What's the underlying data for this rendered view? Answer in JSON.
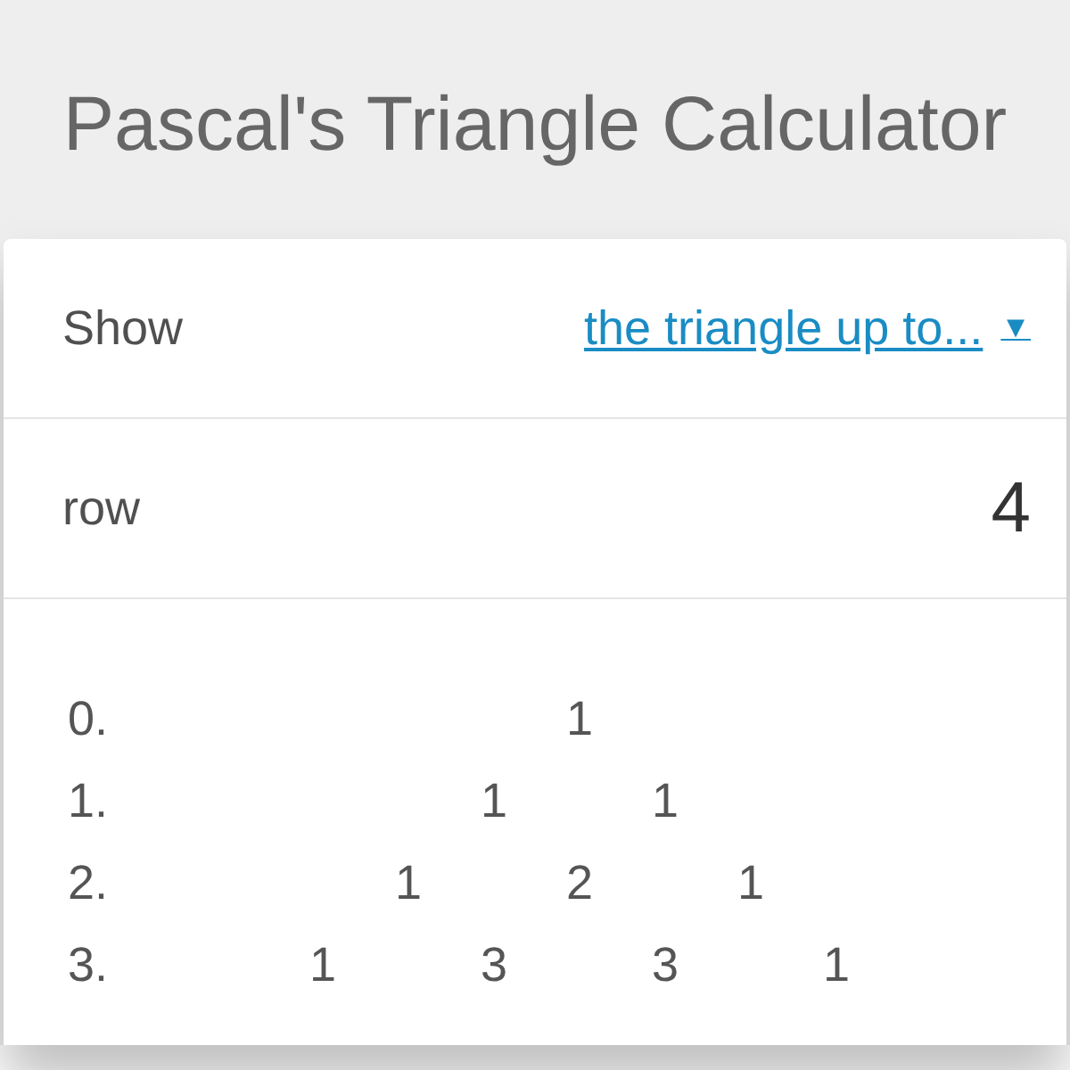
{
  "title": "Pascal's Triangle Calculator",
  "fields": [
    {
      "kind": "dropdown",
      "label": "Show",
      "value": "the triangle up to...",
      "caret": "▼"
    },
    {
      "kind": "number",
      "label": "row",
      "value": "4"
    }
  ],
  "triangle": [
    {
      "label": "0.",
      "values": [
        "1"
      ]
    },
    {
      "label": "1.",
      "values": [
        "1",
        "1"
      ]
    },
    {
      "label": "2.",
      "values": [
        "1",
        "2",
        "1"
      ]
    },
    {
      "label": "3.",
      "values": [
        "1",
        "3",
        "3",
        "1"
      ]
    }
  ]
}
